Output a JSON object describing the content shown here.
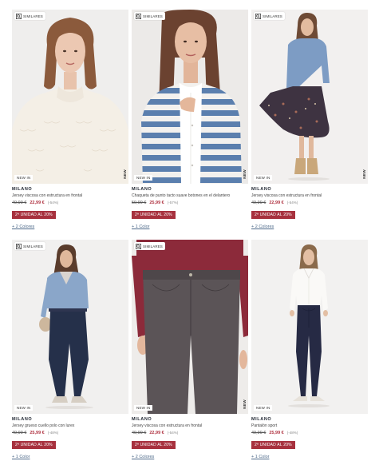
{
  "similar_label": "SIMILARES",
  "newin_label": "NEW IN",
  "new_vertical_label": "NEW",
  "promo_label": "2ª UNIDAD AL 20%",
  "colors": {
    "price_sale": "#b03442",
    "promo_bg": "#a7313e",
    "link": "#4e6a8a"
  },
  "products": [
    {
      "brand": "MILANO",
      "description": "Jersey viscosa con estructura en frontal",
      "old_price": "49,99 €",
      "price": "22,99 €",
      "discount": "(-54%)",
      "colors_link": "+ 2 Colores",
      "has_similares": true,
      "has_new": true
    },
    {
      "brand": "MILANO",
      "description": "Chaqueta de punto tacto suave botones en el delantero",
      "old_price": "59,99 €",
      "price": "25,99 €",
      "discount": "(-57%)",
      "colors_link": "+ 1 Color",
      "has_similares": true,
      "has_new": true
    },
    {
      "brand": "MILANO",
      "description": "Jersey viscosa con estructura en frontal",
      "old_price": "49,99 €",
      "price": "22,99 €",
      "discount": "(-54%)",
      "colors_link": "+ 2 Colores",
      "has_similares": true,
      "has_new": true
    },
    {
      "brand": "MILANO",
      "description": "Jersey grueso cuello polo con lurex",
      "old_price": "49,99 €",
      "price": "25,99 €",
      "discount": "(-48%)",
      "colors_link": "+ 1 Color",
      "has_similares": true,
      "has_new": false
    },
    {
      "brand": "MILANO",
      "description": "Jersey viscosa con estructura en frontal",
      "old_price": "49,99 €",
      "price": "22,99 €",
      "discount": "(-54%)",
      "colors_link": "+ 2 Colores",
      "has_similares": true,
      "has_new": true
    },
    {
      "brand": "MILANO",
      "description": "Pantalón sport",
      "old_price": "49,99 €",
      "price": "25,99 €",
      "discount": "(-48%)",
      "colors_link": "+ 1 Color",
      "has_similares": false,
      "has_new": false
    }
  ]
}
